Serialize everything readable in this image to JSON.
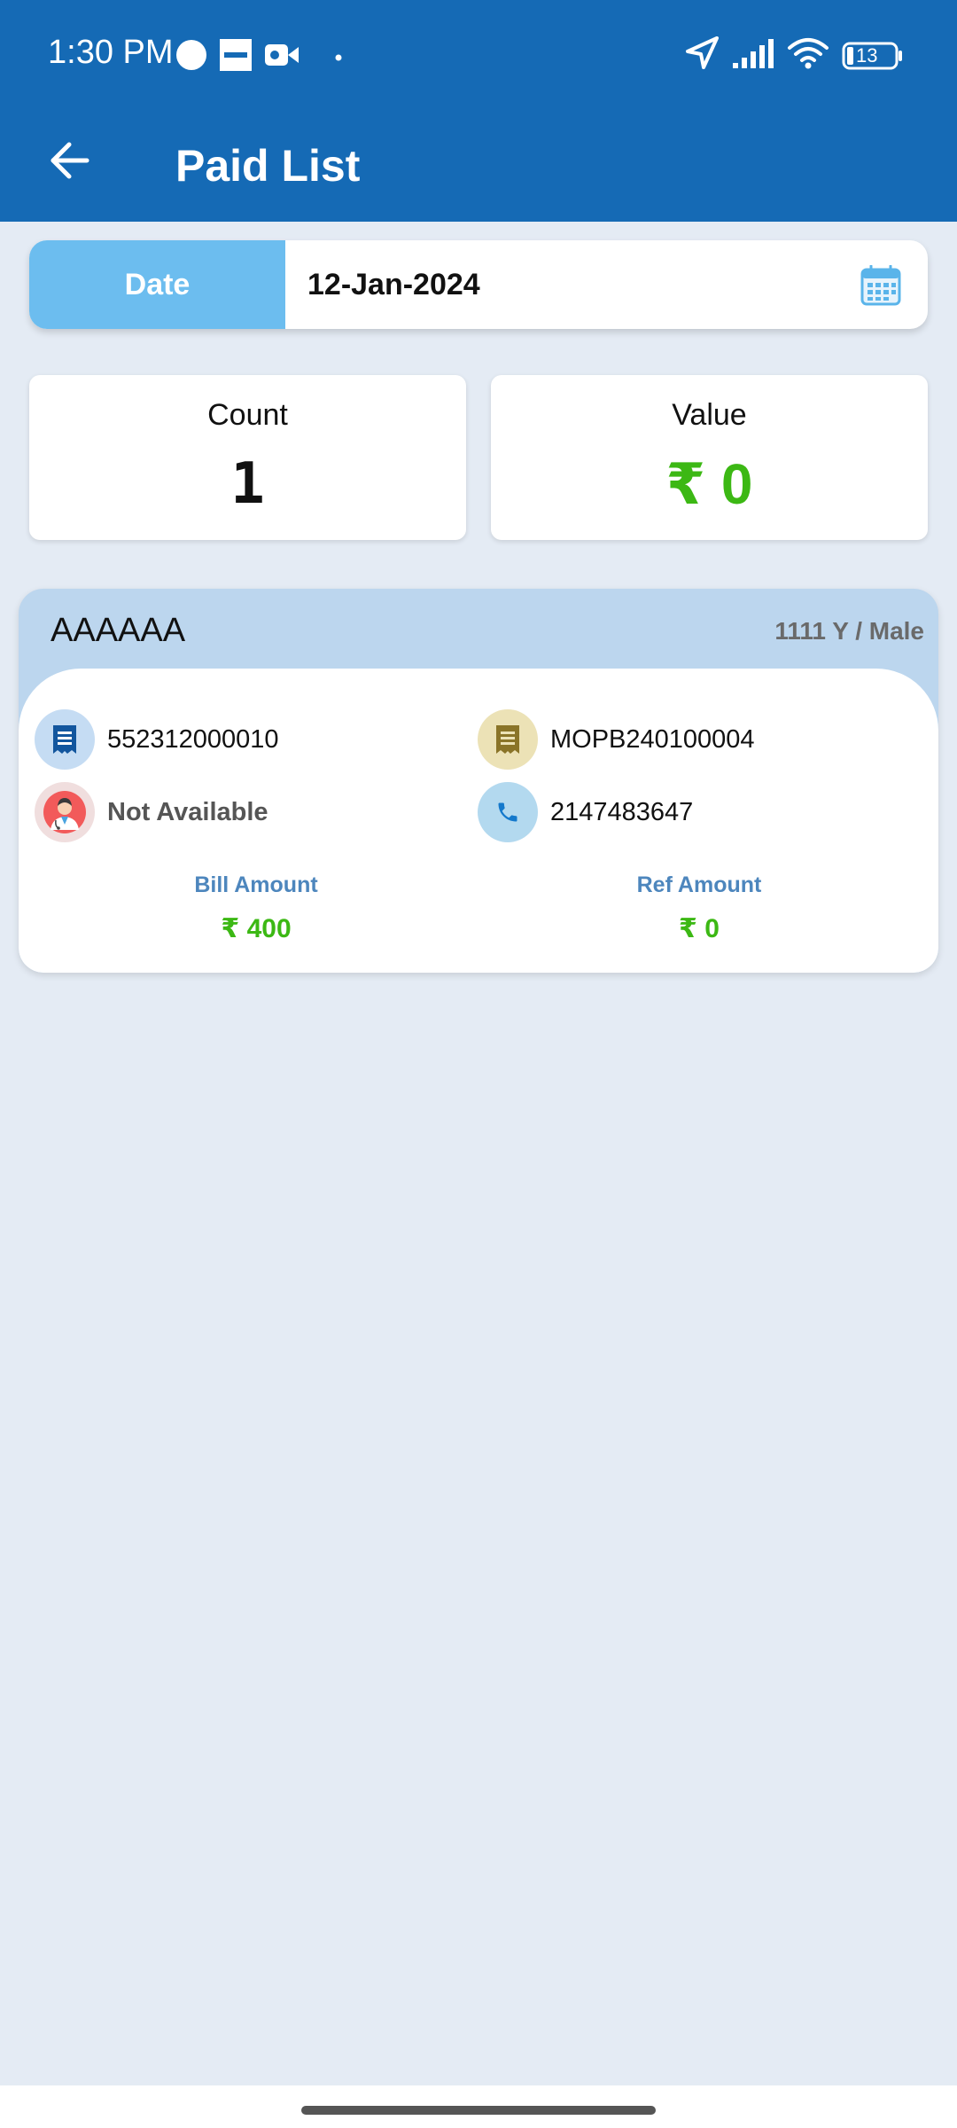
{
  "status_bar": {
    "time": "1:30 PM",
    "battery": "13",
    "left_icons": [
      "circle-icon",
      "zomato-icon",
      "video-camera-icon",
      "dot-icon"
    ],
    "right_icons": [
      "location-arrow-icon",
      "signal-icon",
      "wifi-icon",
      "battery-icon"
    ]
  },
  "toolbar": {
    "back_icon": "back-arrow-icon",
    "title": "Paid List"
  },
  "date_filter": {
    "label": "Date",
    "value": "12-Jan-2024",
    "icon": "calendar-icon"
  },
  "summary": {
    "count_label": "Count",
    "count_value": "1",
    "value_label": "Value",
    "value_amount": "₹ 0"
  },
  "records": [
    {
      "name": "AAAAAA",
      "age_gender": "1111 Y / Male",
      "bill_number": "552312000010",
      "receipt_number": "MOPB240100004",
      "doctor": "Not Available",
      "phone": "2147483647",
      "bill_amount_label": "Bill Amount",
      "bill_amount": "₹ 400",
      "ref_amount_label": "Ref Amount",
      "ref_amount": "₹ 0"
    }
  ],
  "colors": {
    "app_bar": "#156ab5",
    "background": "#e4ebf4",
    "date_label_bg": "#6cbdef",
    "card_header_bg": "#bcd6ee",
    "amount_green": "#3cb814",
    "amount_label_blue": "#4d86bd"
  }
}
